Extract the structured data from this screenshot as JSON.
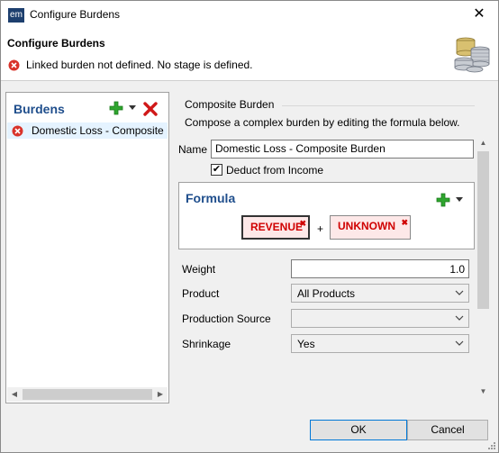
{
  "window": {
    "title": "Configure Burdens",
    "app_icon_text": "em"
  },
  "header": {
    "title": "Configure Burdens",
    "message": "Linked burden not defined. No stage is defined.",
    "message_icon": "error-icon",
    "illustration": "coins-icon"
  },
  "burdens": {
    "heading": "Burdens",
    "items": [
      {
        "label": "Domestic Loss - Composite B",
        "status_icon": "error-icon",
        "selected": true
      }
    ]
  },
  "composite": {
    "section_title": "Composite Burden",
    "description": "Compose a complex burden by editing the formula below.",
    "name_label": "Name",
    "name_value": "Domestic Loss - Composite Burden",
    "deduct_label": "Deduct from Income",
    "deduct_checked": true
  },
  "formula": {
    "heading": "Formula",
    "tokens": [
      "REVENUE",
      "UNKNOWN"
    ],
    "operator": "+"
  },
  "fields": {
    "weight_label": "Weight",
    "weight_value": "1.0",
    "product_label": "Product",
    "product_value": "All Products",
    "production_source_label": "Production Source",
    "production_source_value": "",
    "shrinkage_label": "Shrinkage",
    "shrinkage_value": "Yes"
  },
  "buttons": {
    "ok": "OK",
    "cancel": "Cancel"
  },
  "colors": {
    "accent": "#1f4e8c",
    "error": "#d00000",
    "add_green": "#2ea52e",
    "selection": "#e5f3ff"
  }
}
